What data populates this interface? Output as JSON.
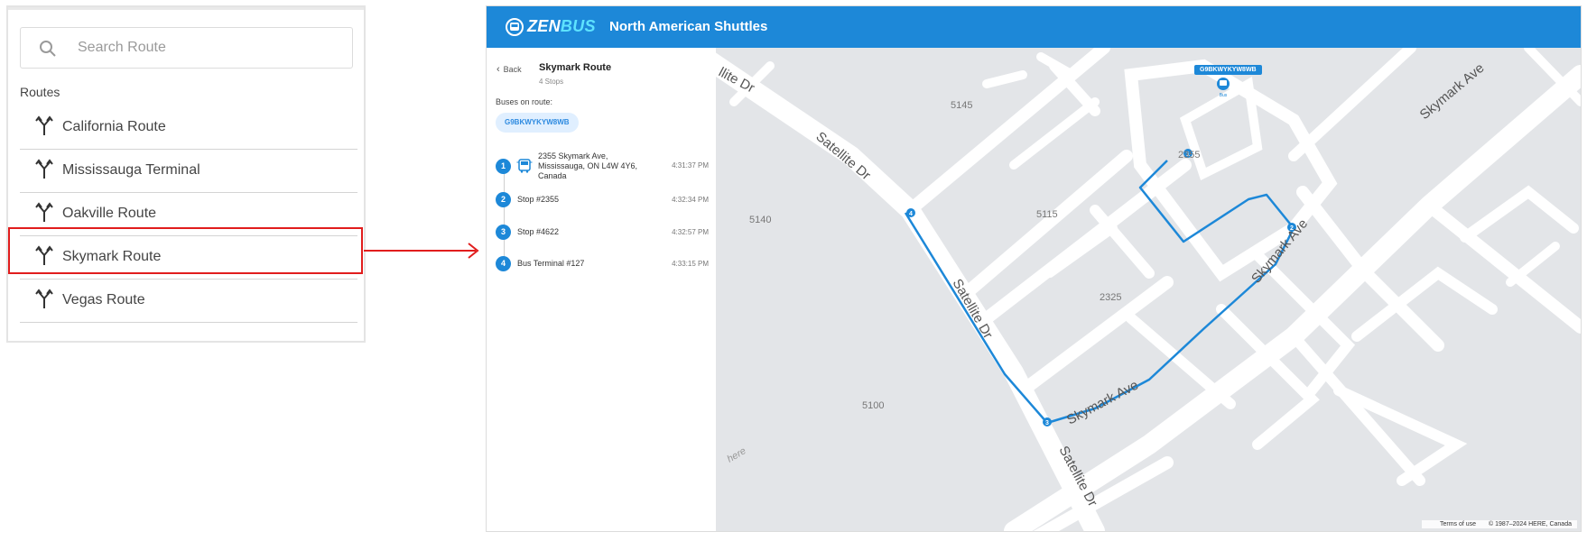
{
  "route_panel": {
    "search_placeholder": "Search Route",
    "routes_title": "Routes",
    "routes": [
      {
        "label": "California Route"
      },
      {
        "label": "Mississauga Terminal"
      },
      {
        "label": "Oakville Route"
      },
      {
        "label": "Skymark Route"
      },
      {
        "label": "Vegas Route"
      }
    ],
    "selected_route": "Skymark Route"
  },
  "app": {
    "brand_part1": "ZEN",
    "brand_part2": "BUS",
    "title": "North American Shuttles",
    "colors": {
      "header": "#1d88d8",
      "accent": "#1d88d8",
      "highlight": "#e11d1d"
    }
  },
  "sidebar": {
    "back_label": "Back",
    "route_name": "Skymark Route",
    "stops_count": "4 Stops",
    "buses_label": "Buses on route:",
    "bus_id": "G9BKWYKYW8WB",
    "stops": [
      {
        "num": "1",
        "name": "2355 Skymark Ave, Mississauga, ON L4W 4Y6, Canada",
        "time": "4:31:37 PM",
        "has_bus": true
      },
      {
        "num": "2",
        "name": "Stop #2355",
        "time": "4:32:34 PM"
      },
      {
        "num": "3",
        "name": "Stop #4622",
        "time": "4:32:57 PM"
      },
      {
        "num": "4",
        "name": "Bus Terminal #127",
        "time": "4:33:15 PM"
      }
    ]
  },
  "map": {
    "bus_tag": "G9BKWYKYW8WB",
    "bus_icon_label": "Bus",
    "streets": [
      "llite Dr",
      "Satellite Dr",
      "Satellite Dr",
      "Satellite Dr",
      "Skymark Ave",
      "Skymark Ave",
      "Skymark Ave"
    ],
    "area_numbers": [
      "5145",
      "5140",
      "5115",
      "2325",
      "5100",
      "2355"
    ],
    "stop_markers": [
      "1",
      "2",
      "3",
      "4"
    ],
    "watermark": "here",
    "terms": "Terms of use",
    "copyright": "© 1987–2024 HERE, Canada"
  }
}
